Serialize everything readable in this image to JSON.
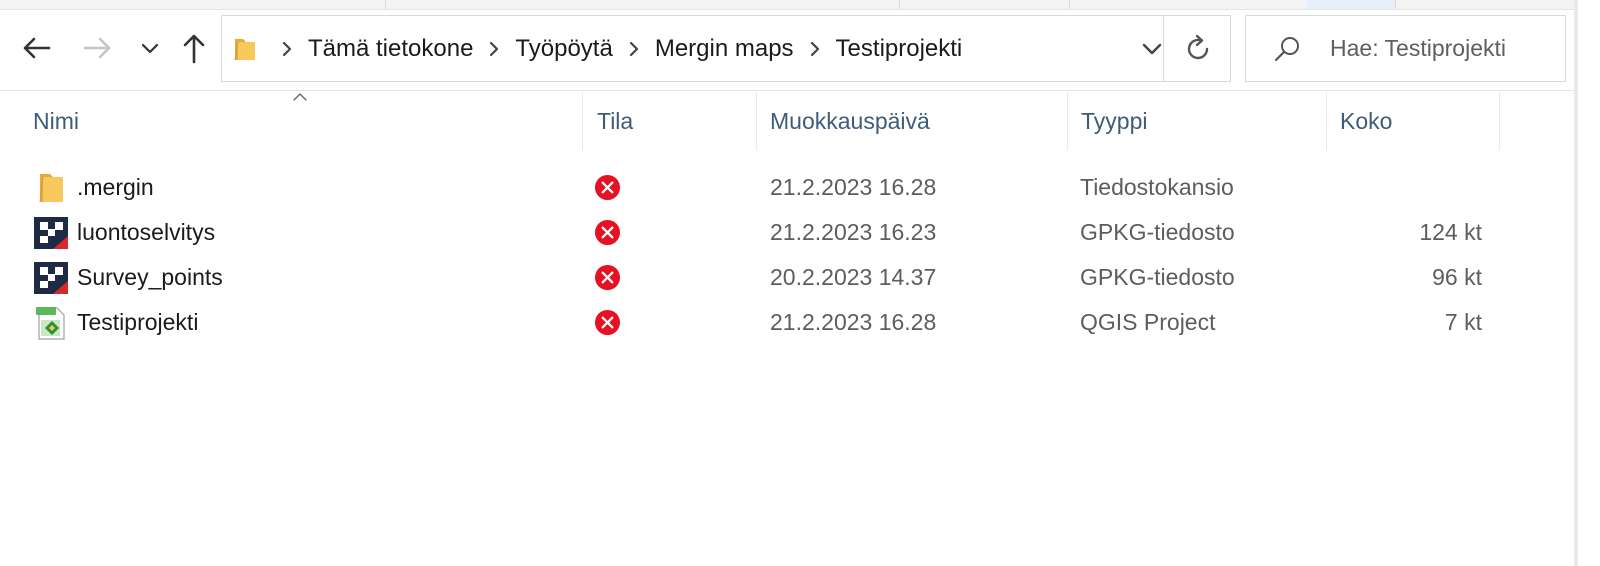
{
  "nav": {
    "back_icon": "back-arrow-icon",
    "forward_icon": "forward-arrow-icon",
    "recent_icon": "chevron-down-icon",
    "up_icon": "up-arrow-icon"
  },
  "address": {
    "folder_icon": "folder-icon",
    "crumbs": [
      "Tämä tietokone",
      "Työpöytä",
      "Mergin maps",
      "Testiprojekti"
    ],
    "dropdown_icon": "chevron-down-icon",
    "refresh_icon": "refresh-icon"
  },
  "search": {
    "icon": "search-icon",
    "placeholder": "Hae: Testiprojekti"
  },
  "columns": {
    "name": "Nimi",
    "status": "Tila",
    "modified": "Muokkauspäivä",
    "type": "Tyyppi",
    "size": "Koko",
    "sorted_by": "name"
  },
  "files": [
    {
      "name": ".mergin",
      "icon": "folder-icon",
      "status": "error-icon",
      "modified": "21.2.2023 16.28",
      "type": "Tiedostokansio",
      "size": ""
    },
    {
      "name": "luontoselvitys",
      "icon": "gpkg-file-icon",
      "status": "error-icon",
      "modified": "21.2.2023 16.23",
      "type": "GPKG-tiedosto",
      "size": "124 kt"
    },
    {
      "name": "Survey_points",
      "icon": "gpkg-file-icon",
      "status": "error-icon",
      "modified": "20.2.2023 14.37",
      "type": "GPKG-tiedosto",
      "size": "96 kt"
    },
    {
      "name": "Testiprojekti",
      "icon": "qgs-file-icon",
      "status": "error-icon",
      "modified": "21.2.2023 16.28",
      "type": "QGIS Project",
      "size": "7 kt"
    }
  ],
  "colors": {
    "header_text": "#3e5c7a",
    "folder": "#f7c95c",
    "status_error": "#e81123",
    "gpkg_dark": "#1f2a44",
    "gpkg_red": "#d9272e",
    "qgs_green": "#5cb85c"
  }
}
